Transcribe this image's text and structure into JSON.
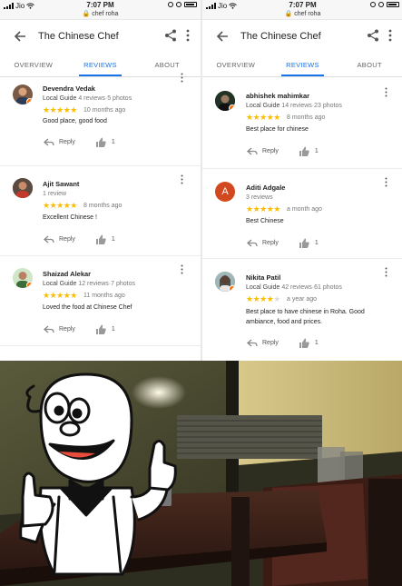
{
  "status_bar": {
    "carrier": "Jio",
    "time": "7:07 PM",
    "url": "chef roha"
  },
  "app_bar": {
    "title": "The Chinese Chef",
    "back_icon": "arrow-back-icon",
    "share_icon": "share-icon",
    "more_icon": "more-vert-icon"
  },
  "tabs": [
    {
      "label": "OVERVIEW",
      "active": false
    },
    {
      "label": "REVIEWS",
      "active": true
    },
    {
      "label": "ABOUT",
      "active": false
    }
  ],
  "colors": {
    "accent": "#1a73e8",
    "star": "#fbbc04",
    "local_guide_badge": "#ff6d00"
  },
  "left_reviews": [
    {
      "name": "Devendra Vedak",
      "guide": "Local Guide",
      "meta": "4 reviews·5 photos",
      "rating": 5,
      "time": "10 months ago",
      "text": "Good place, good food",
      "reply": "Reply",
      "likes": "1"
    },
    {
      "name": "Ajit Sawant",
      "guide": "",
      "meta": "1 review",
      "rating": 5,
      "time": "8 months ago",
      "text": "Excellent Chinese !",
      "reply": "Reply",
      "likes": "1"
    },
    {
      "name": "Shaizad Alekar",
      "guide": "Local Guide",
      "meta": "12 reviews·7 photos",
      "rating": 5,
      "time": "11 months ago",
      "text": "Loved the food at Chinese Chef",
      "reply": "Reply",
      "likes": "1"
    }
  ],
  "right_reviews": [
    {
      "name": "abhishek mahimkar",
      "guide": "Local Guide",
      "meta": "14 reviews·23 photos",
      "rating": 5,
      "time": "8 months ago",
      "text": "Best place for chinese",
      "reply": "Reply",
      "likes": "1"
    },
    {
      "name": "Aditi Adgale",
      "guide": "",
      "meta": "3 reviews",
      "rating": 5,
      "time": "a month ago",
      "text": "Best Chinese",
      "reply": "Reply",
      "likes": "1",
      "initial": "A"
    },
    {
      "name": "Nikita Patil",
      "guide": "Local Guide",
      "meta": "42 reviews·61 photos",
      "rating": 4,
      "time": "a year ago",
      "text": "Best place to have chinese in Roha. Good ambiance, food and prices.",
      "reply": "Reply",
      "likes": "1"
    }
  ],
  "photo": {
    "description_icon": "restaurant-interior-photo",
    "mascot_icon": "thumbs-up-chef-mascot-icon"
  }
}
